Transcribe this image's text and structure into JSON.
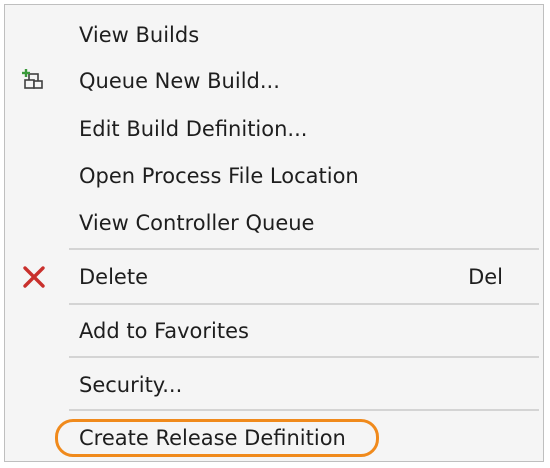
{
  "context_menu": {
    "items": [
      {
        "label": "View Builds",
        "shortcut": "",
        "icon": ""
      },
      {
        "label": "Queue New Build...",
        "shortcut": "",
        "icon": "queue-build-icon"
      },
      {
        "label": "Edit Build Definition...",
        "shortcut": "",
        "icon": ""
      },
      {
        "label": "Open Process File Location",
        "shortcut": "",
        "icon": ""
      },
      {
        "label": "View Controller Queue",
        "shortcut": "",
        "icon": ""
      },
      {
        "label": "Delete",
        "shortcut": "Del",
        "icon": "delete-x-icon"
      },
      {
        "label": "Add to Favorites",
        "shortcut": "",
        "icon": ""
      },
      {
        "label": "Security...",
        "shortcut": "",
        "icon": ""
      },
      {
        "label": "Create Release Definition",
        "shortcut": "",
        "icon": ""
      }
    ]
  },
  "colors": {
    "menu_background": "#f5f5f5",
    "text": "#1e1e1e",
    "separator": "#d4d4d4",
    "delete_icon": "#c9302c",
    "highlight_ring": "#f08a1c",
    "queue_icon_plus": "#3a9a3a"
  },
  "highlighted_item": "Create Release Definition"
}
